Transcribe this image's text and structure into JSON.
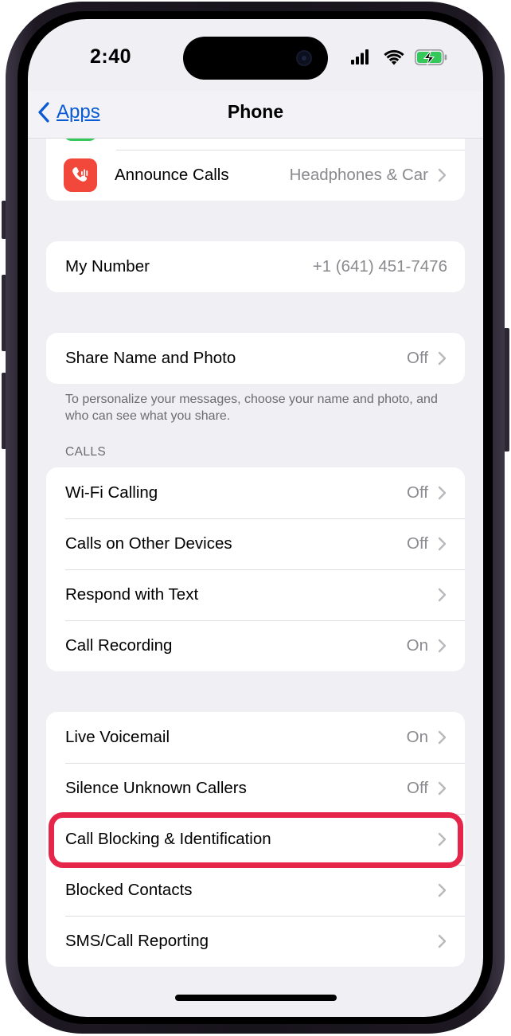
{
  "status_bar": {
    "time": "2:40"
  },
  "nav": {
    "back_label": "Apps",
    "title": "Phone"
  },
  "announce_calls": {
    "label": "Announce Calls",
    "value": "Headphones & Car",
    "icon": "phone-waveform-icon",
    "icon_color": "#f2473b"
  },
  "my_number": {
    "label": "My Number",
    "value": "+1 (641) 451-7476"
  },
  "share_name": {
    "label": "Share Name and Photo",
    "value": "Off",
    "footer": "To personalize your messages, choose your name and photo, and who can see what you share."
  },
  "calls": {
    "header": "CALLS",
    "rows": [
      {
        "label": "Wi-Fi Calling",
        "value": "Off"
      },
      {
        "label": "Calls on Other Devices",
        "value": "Off"
      },
      {
        "label": "Respond with Text",
        "value": ""
      },
      {
        "label": "Call Recording",
        "value": "On"
      }
    ]
  },
  "blocking": {
    "rows": [
      {
        "label": "Live Voicemail",
        "value": "On"
      },
      {
        "label": "Silence Unknown Callers",
        "value": "Off"
      },
      {
        "label": "Call Blocking & Identification",
        "value": ""
      },
      {
        "label": "Blocked Contacts",
        "value": ""
      },
      {
        "label": "SMS/Call Reporting",
        "value": ""
      }
    ]
  },
  "colors": {
    "accent": "#0a5bd3",
    "highlight": "#e5264a",
    "green_icon": "#34c759"
  }
}
